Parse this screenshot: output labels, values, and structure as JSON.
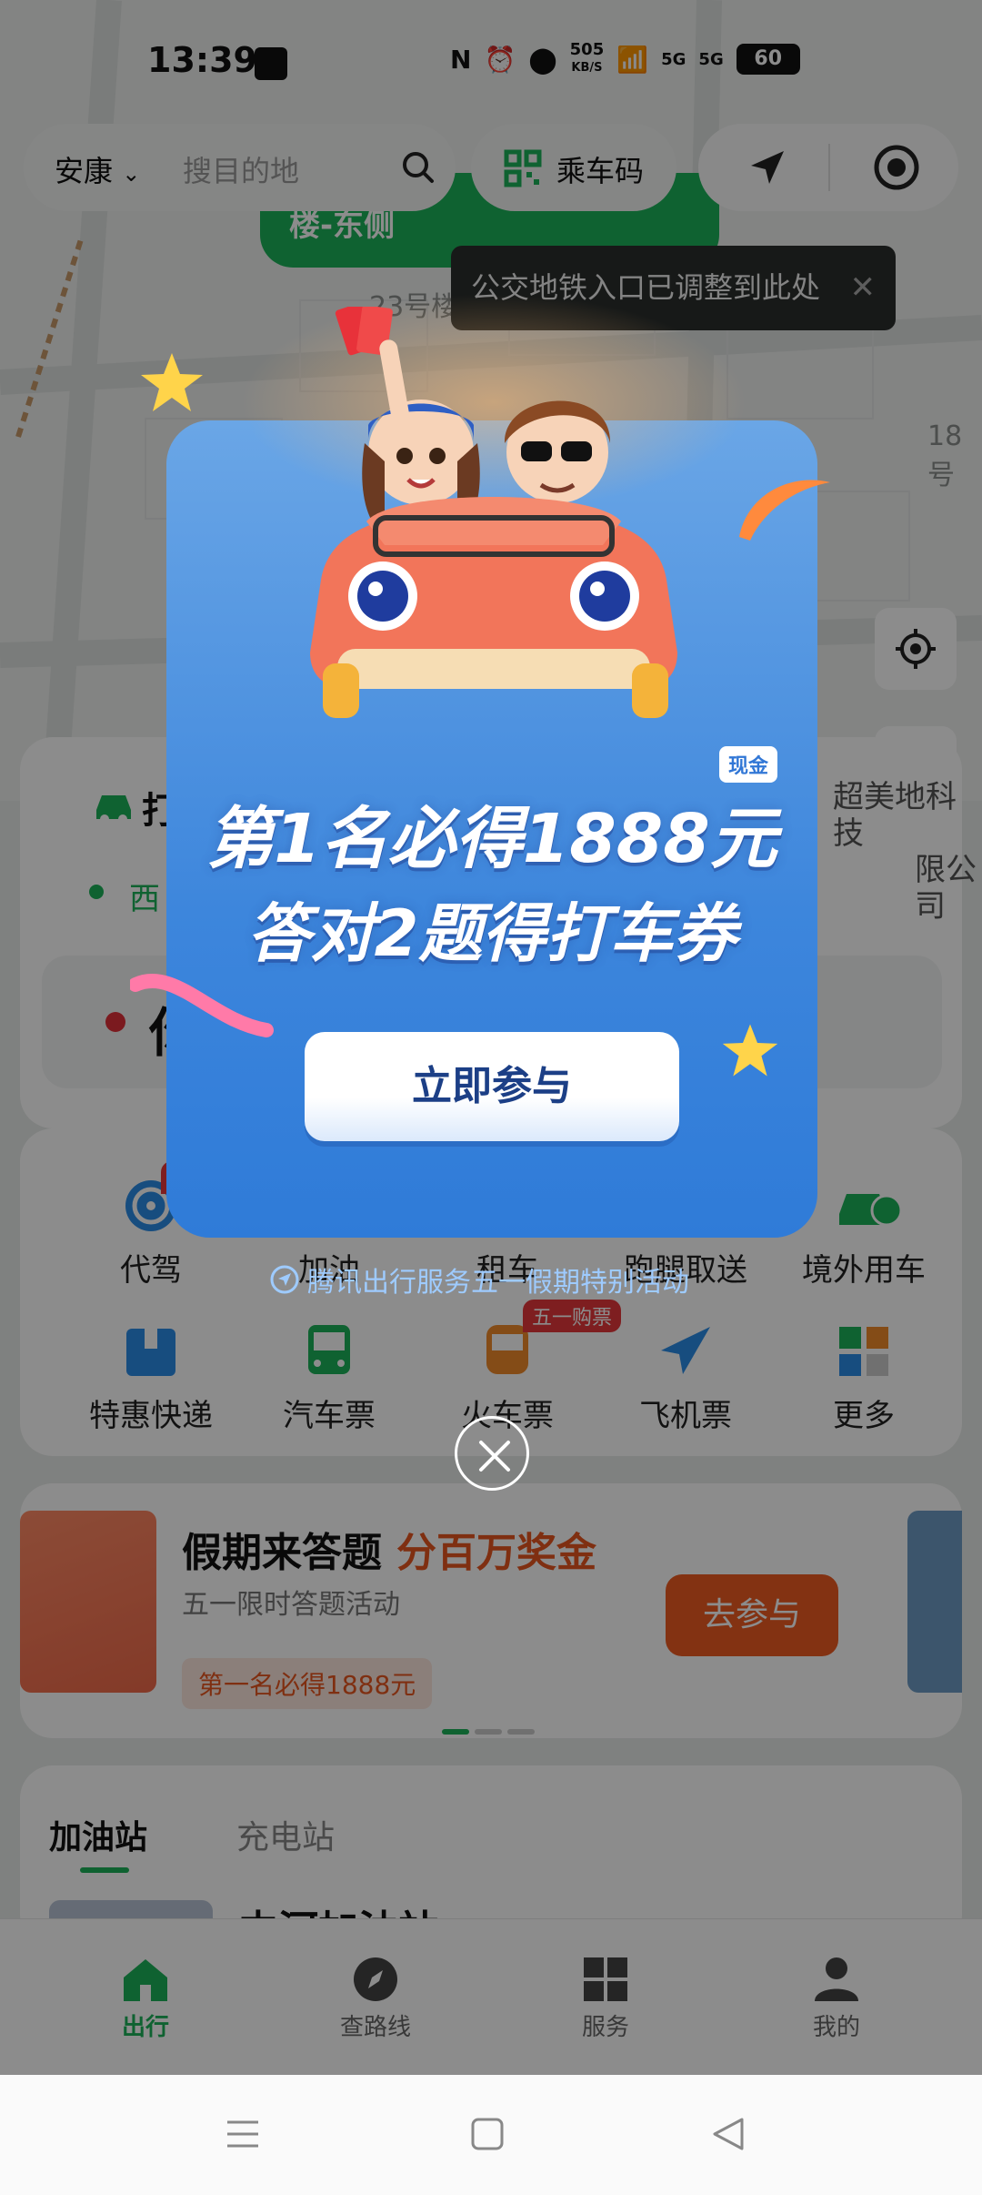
{
  "status_bar": {
    "time": "13:39",
    "network_speed_value": "505",
    "network_speed_unit": "KB/S",
    "signal_1": "5G",
    "signal_2": "5G",
    "battery": "60"
  },
  "top_bar": {
    "city": "安康",
    "search_placeholder": "搜目的地",
    "ride_code_label": "乘车码"
  },
  "map": {
    "sign_text": "楼-东侧",
    "label_building": "23号楼",
    "label_right": "18号",
    "toast_text": "公交地铁入口已调整到此处",
    "poi_line1": "超美地科技",
    "poi_line2": "限公司"
  },
  "ride_card": {
    "title": "打",
    "from": "西",
    "to": "你"
  },
  "services": {
    "row1": [
      {
        "label": "代驾",
        "icon": "steering-wheel-icon",
        "badge": "限"
      },
      {
        "label": "加油",
        "icon": "gas-pump-icon"
      },
      {
        "label": "租车",
        "icon": "car-key-icon"
      },
      {
        "label": "跑腿取送",
        "icon": "delivery-icon"
      },
      {
        "label": "境外用车",
        "icon": "global-car-icon"
      }
    ],
    "row2": [
      {
        "label": "特惠快递",
        "icon": "package-icon"
      },
      {
        "label": "汽车票",
        "icon": "bus-icon"
      },
      {
        "label": "火车票",
        "icon": "train-icon",
        "badge": "五一购票"
      },
      {
        "label": "飞机票",
        "icon": "plane-icon"
      },
      {
        "label": "更多",
        "icon": "grid-icon"
      }
    ]
  },
  "promo": {
    "title": "假期来答题",
    "highlight": "分百万奖金",
    "subtitle": "五一限时答题活动",
    "tag": "第一名必得1888元",
    "button": "去参与"
  },
  "stations": {
    "tab_gas": "加油站",
    "tab_charge": "充电站",
    "first_station": "中河加油站"
  },
  "tabbar": {
    "items": [
      {
        "label": "出行",
        "active": true
      },
      {
        "label": "查路线",
        "active": false
      },
      {
        "label": "服务",
        "active": false
      },
      {
        "label": "我的",
        "active": false
      }
    ]
  },
  "popup": {
    "cash_tag": "现金",
    "line1": "第1名必得1888元",
    "line2": "答对2题得打车券",
    "button": "立即参与",
    "footer": "腾讯出行服务五一假期特别活动"
  },
  "colors": {
    "brand_green": "#1db35a",
    "popup_blue": "#3d86dc",
    "accent_orange": "#ee5b22"
  }
}
